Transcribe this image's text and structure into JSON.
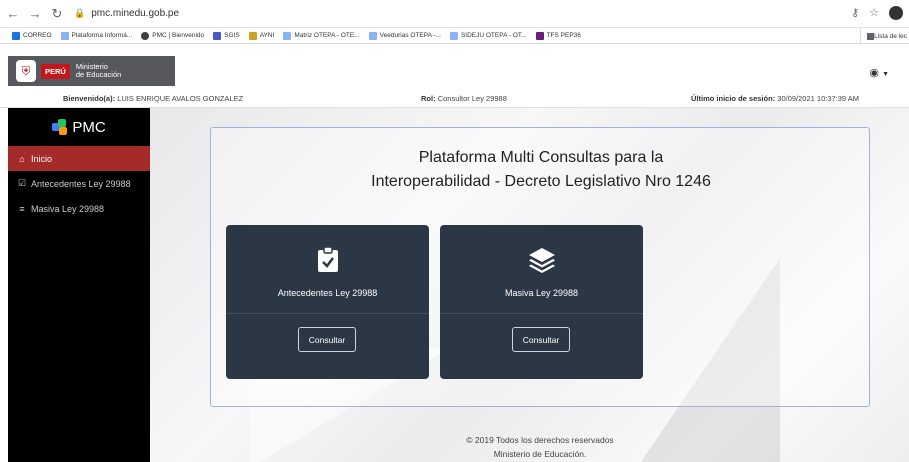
{
  "browser": {
    "url": "pmc.minedu.gob.pe",
    "bookmarks": [
      {
        "label": "CORREO",
        "color": "#1a73e8"
      },
      {
        "label": "Plataforma Informá...",
        "color": "#8ab4f8"
      },
      {
        "label": "PMC | Bienvenido",
        "color": "#3c4043"
      },
      {
        "label": "SGIS",
        "color": "#4a56c4"
      },
      {
        "label": "AYNI",
        "color": "#c9a227"
      },
      {
        "label": "Matriz OTEPA - OTE...",
        "color": "#8ab4f8"
      },
      {
        "label": "Veedurias OTEPA -...",
        "color": "#8ab4f8"
      },
      {
        "label": "SIDEJU OTEPA - OT...",
        "color": "#8ab4f8"
      },
      {
        "label": "TFS PEP36",
        "color": "#68217a"
      }
    ],
    "reading_list": "Lista de lec"
  },
  "header": {
    "peru": "PERÚ",
    "ministerio_line1": "Ministerio",
    "ministerio_line2": "de Educación",
    "user_icon": "user-circle-icon"
  },
  "userbar": {
    "welcome_label": "Bienvenido(a):",
    "welcome_value": "LUIS ENRIQUE AVALOS GONZALEZ",
    "role_label": "Rol:",
    "role_value": "Consultor Ley 29988",
    "last_login_label": "Último inicio de sesión:",
    "last_login_value": "30/09/2021 10:37:39 AM"
  },
  "sidebar": {
    "brand": "PMC",
    "items": [
      {
        "label": "Inicio",
        "icon": "home-icon",
        "active": true
      },
      {
        "label": "Antecedentes Ley 29988",
        "icon": "clipboard-check-icon",
        "active": false
      },
      {
        "label": "Masiva Ley 29988",
        "icon": "layers-icon",
        "active": false
      }
    ]
  },
  "main": {
    "title_line1": "Plataforma Multi Consultas para la",
    "title_line2": "Interoperabilidad - Decreto Legislativo Nro 1246",
    "cards": [
      {
        "label": "Antecedentes Ley 29988",
        "button": "Consultar",
        "icon": "clipboard-check-icon"
      },
      {
        "label": "Masiva Ley 29988",
        "button": "Consultar",
        "icon": "layers-icon"
      }
    ]
  },
  "footer": {
    "line1": "© 2019 Todos los derechos reservados",
    "line2": "Ministerio de Educación."
  }
}
